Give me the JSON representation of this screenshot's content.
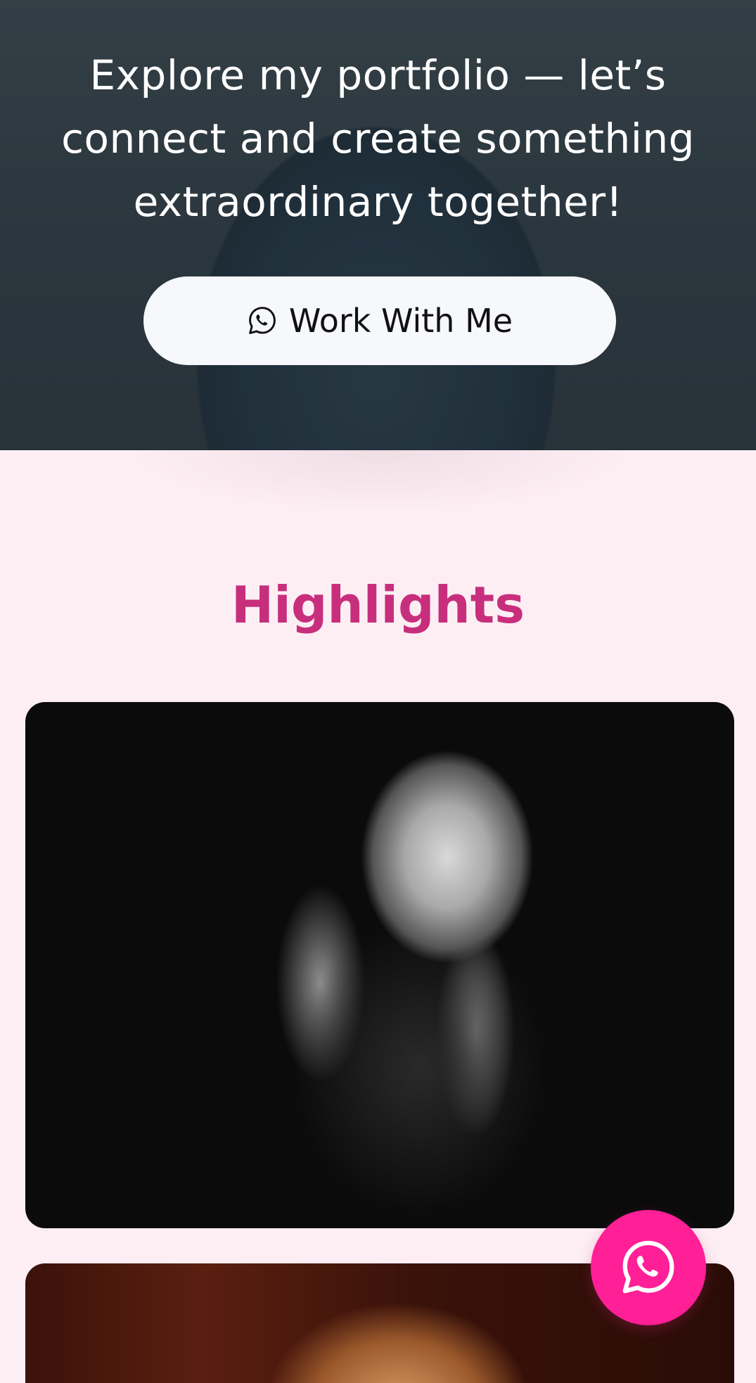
{
  "hero": {
    "tagline": "Explore my portfolio — let’s connect and create something extraordinary together!",
    "cta": {
      "label": "Work With Me",
      "icon": "whatsapp-icon"
    }
  },
  "highlights": {
    "title": "Highlights",
    "items": [
      {
        "image": "portrait-black-and-white"
      },
      {
        "image": "portrait-warm-tones"
      }
    ]
  },
  "floating_button": {
    "icon": "whatsapp-icon"
  },
  "colors": {
    "accent": "#c72f7d",
    "fab": "#ff1f97",
    "section_background": "#fdeef4",
    "button_background": "#f6f8fb"
  }
}
